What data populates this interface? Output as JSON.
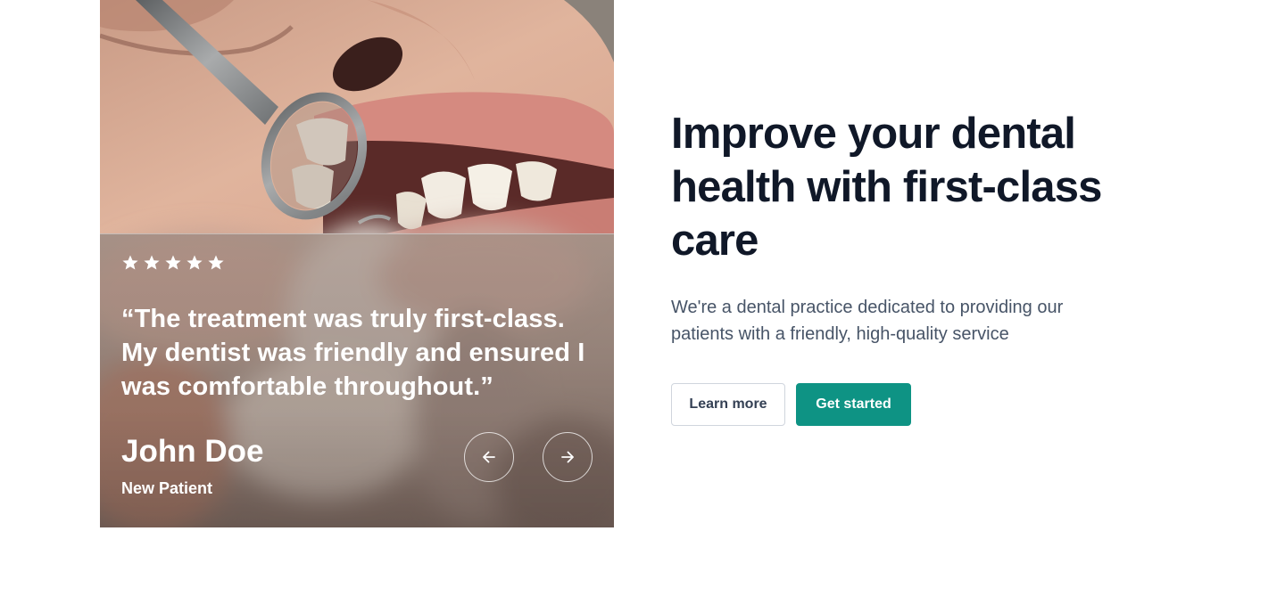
{
  "testimonial": {
    "rating": 5,
    "quote": "“The treatment was truly first-class. My dentist was friendly and ensured I was comfortable throughout.”",
    "author_name": "John Doe",
    "author_role": "New Patient",
    "prev_icon": "arrow-left-icon",
    "next_icon": "arrow-right-icon"
  },
  "hero": {
    "headline": "Improve your dental health with first-class care",
    "subtext": "We're a dental practice dedicated to providing our patients with a friendly, high-quality service",
    "learn_more_label": "Learn more",
    "get_started_label": "Get started"
  },
  "colors": {
    "primary": "#0e9384",
    "heading": "#101828",
    "body": "#475467",
    "border": "#d0d5dd"
  }
}
